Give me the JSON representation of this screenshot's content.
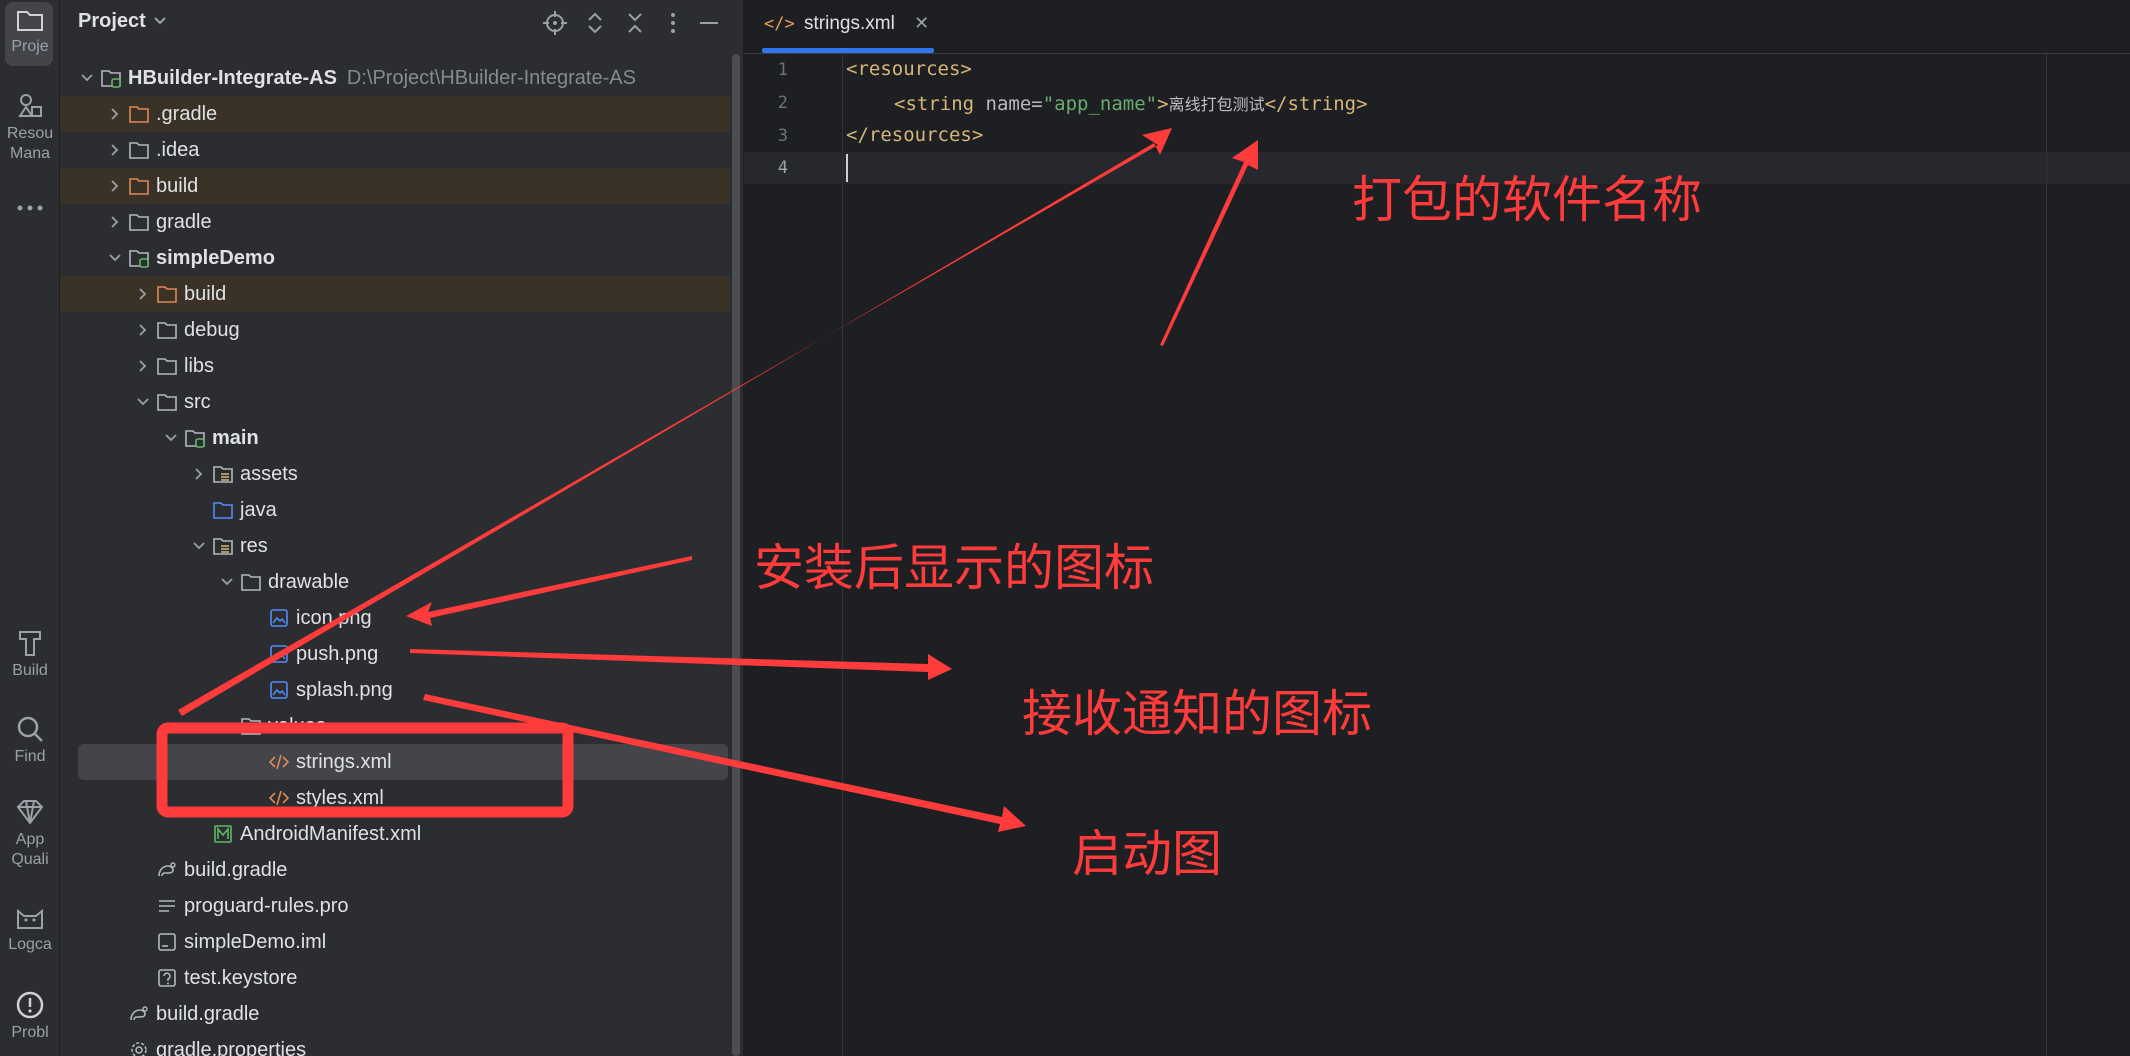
{
  "toolstrip": {
    "items": [
      {
        "label": "Proje",
        "icon": "folder-icon"
      },
      {
        "label": "Resou",
        "label2": "Mana",
        "icon": "resource-manager-icon"
      },
      {
        "label": "Build",
        "icon": "build-hammer-icon"
      },
      {
        "label": "Find",
        "icon": "search-icon"
      },
      {
        "label": "App",
        "label2": "Quali",
        "icon": "gem-icon"
      },
      {
        "label": "Logca",
        "icon": "logcat-icon"
      },
      {
        "label": "Probl",
        "icon": "problems-icon"
      }
    ]
  },
  "project_panel": {
    "title": "Project",
    "tree": [
      {
        "label": "HBuilder-Integrate-AS",
        "path": "D:\\Project\\HBuilder-Integrate-AS"
      },
      {
        "label": ".gradle"
      },
      {
        "label": ".idea"
      },
      {
        "label": "build"
      },
      {
        "label": "gradle"
      },
      {
        "label": "simpleDemo"
      },
      {
        "label": "build"
      },
      {
        "label": "debug"
      },
      {
        "label": "libs"
      },
      {
        "label": "src"
      },
      {
        "label": "main"
      },
      {
        "label": "assets"
      },
      {
        "label": "java"
      },
      {
        "label": "res"
      },
      {
        "label": "drawable"
      },
      {
        "label": "icon.png"
      },
      {
        "label": "push.png"
      },
      {
        "label": "splash.png"
      },
      {
        "label": "values"
      },
      {
        "label": "strings.xml"
      },
      {
        "label": "styles.xml"
      },
      {
        "label": "AndroidManifest.xml"
      },
      {
        "label": "build.gradle"
      },
      {
        "label": "proguard-rules.pro"
      },
      {
        "label": "simpleDemo.iml"
      },
      {
        "label": "test.keystore"
      },
      {
        "label": "build.gradle"
      },
      {
        "label": "gradle.properties"
      }
    ]
  },
  "editor": {
    "tab_label": "strings.xml",
    "line_numbers": [
      "1",
      "2",
      "3",
      "4"
    ],
    "lines": {
      "l1_tag": "<resources>",
      "l2_open": "<string",
      "l2_attr": " name=",
      "l2_val": "\"app_name\"",
      "l2_gt": ">",
      "l2_text": "离线打包测试",
      "l2_close": "</string>",
      "l3_tag": "</resources>"
    }
  },
  "annotations": {
    "app_name": "打包的软件名称",
    "install_icon": "安装后显示的图标",
    "notify_icon": "接收通知的图标",
    "splash": "启动图"
  },
  "colors": {
    "accent": "#3574f0",
    "annotation": "#ff3b3b",
    "panel_bg": "#2b2d30",
    "editor_bg": "#1e1f22"
  }
}
